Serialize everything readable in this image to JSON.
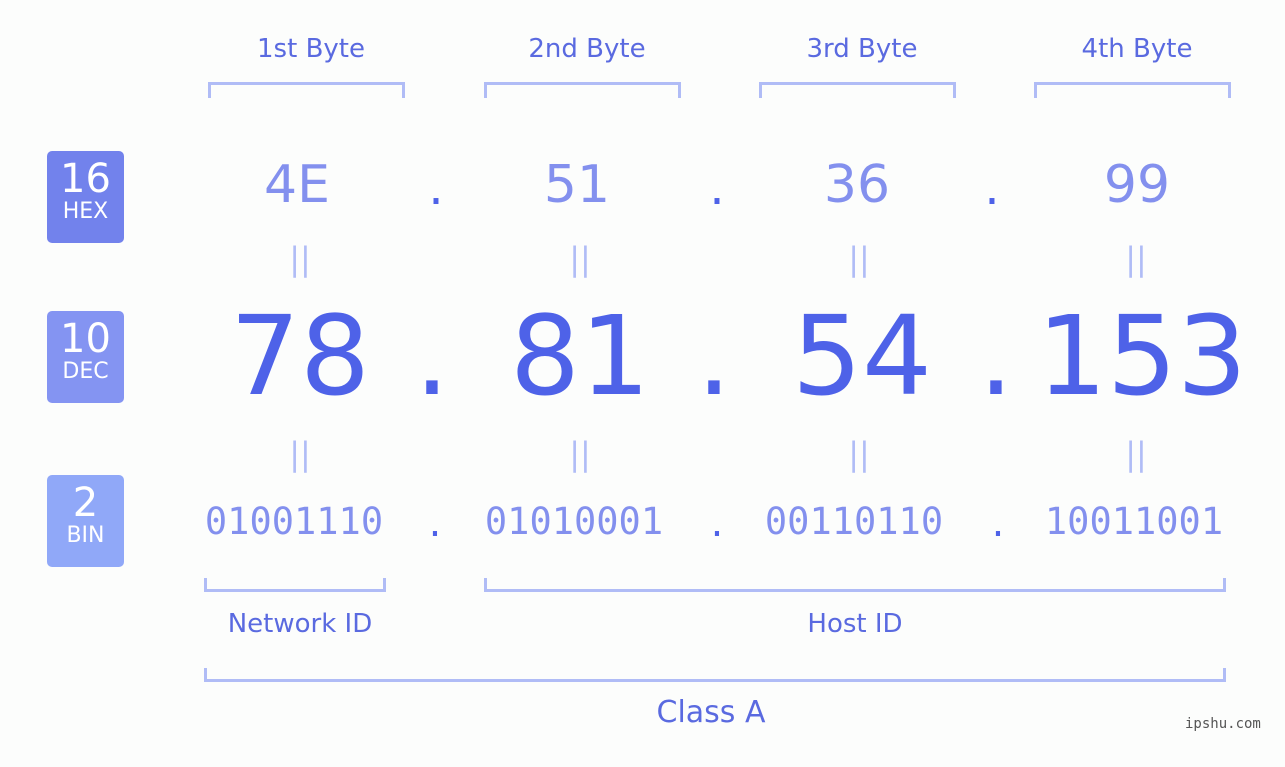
{
  "badges": [
    {
      "number": "16",
      "label": "HEX",
      "color": "#7282ec"
    },
    {
      "number": "10",
      "label": "DEC",
      "color": "#8494f2"
    },
    {
      "number": "2",
      "label": "BIN",
      "color": "#90a8f8"
    }
  ],
  "bytes": [
    {
      "header": "1st Byte",
      "hex": "4E",
      "dec": "78",
      "bin": "01001110"
    },
    {
      "header": "2nd Byte",
      "hex": "51",
      "dec": "81",
      "bin": "01010001"
    },
    {
      "header": "3rd Byte",
      "hex": "36",
      "dec": "54",
      "bin": "00110110"
    },
    {
      "header": "4th Byte",
      "hex": "99",
      "dec": "153",
      "bin": "10011001"
    }
  ],
  "separator": ".",
  "equals": "||",
  "network_id_label": "Network ID",
  "host_id_label": "Host ID",
  "class_label": "Class A",
  "watermark": "ipshu.com"
}
